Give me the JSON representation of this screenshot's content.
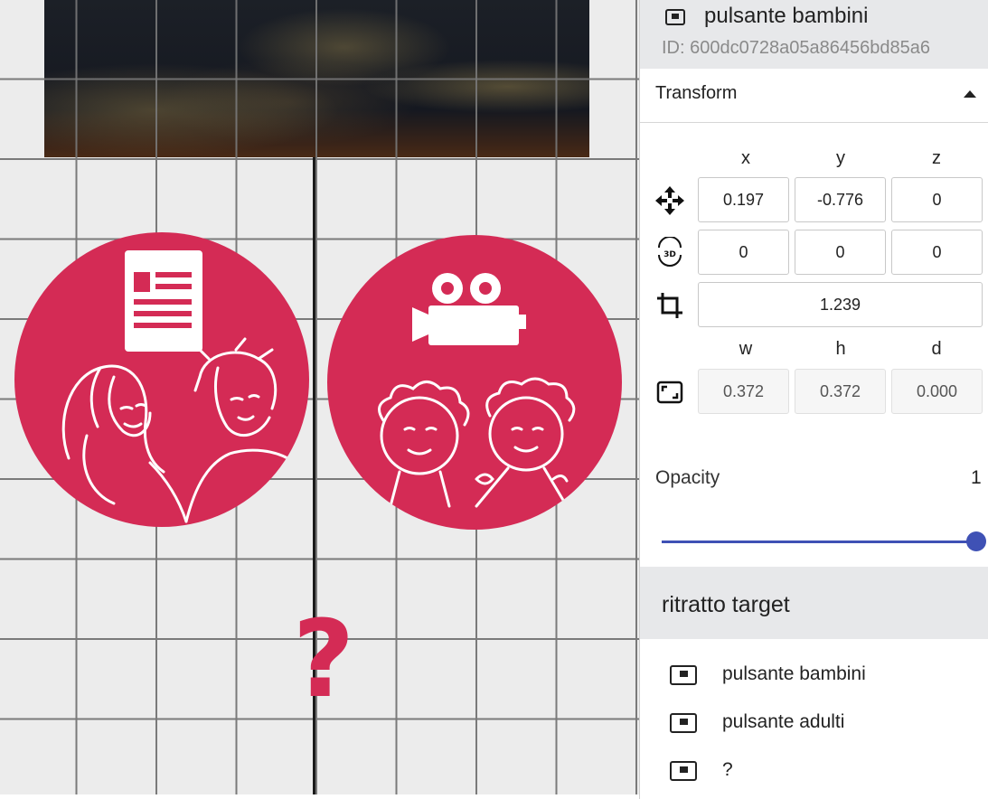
{
  "selected_object": {
    "name": "pulsante bambini",
    "id": "ID: 600dc0728a05a86456bd85a6",
    "icon": "frame-icon"
  },
  "transform": {
    "title": "Transform",
    "columns_xyz": [
      "x",
      "y",
      "z"
    ],
    "columns_whd": [
      "w",
      "h",
      "d"
    ],
    "position": {
      "icon": "move-icon",
      "x": "0.197",
      "y": "-0.776",
      "z": "0"
    },
    "rotation": {
      "icon": "rotate-3d-icon",
      "x": "0",
      "y": "0",
      "z": "0"
    },
    "scale": {
      "icon": "crop-icon",
      "value": "1.239"
    },
    "size": {
      "icon": "resize-icon",
      "w": "0.372",
      "h": "0.372",
      "d": "0.000"
    }
  },
  "opacity": {
    "label": "Opacity",
    "value": "1",
    "level": 1.0,
    "accent": "#3f51b5"
  },
  "scene": {
    "title": "ritratto target",
    "items": [
      {
        "label": "pulsante bambini",
        "icon": "frame-icon"
      },
      {
        "label": "pulsante adulti",
        "icon": "frame-icon"
      },
      {
        "label": "?",
        "icon": "frame-icon"
      }
    ]
  },
  "canvas": {
    "button_color": "#d42b55",
    "question_mark": "?",
    "buttons": [
      {
        "name": "adulti-button",
        "icons": [
          "document-icon",
          "two-adults-drawing"
        ]
      },
      {
        "name": "bambini-button",
        "icons": [
          "video-camera-icon",
          "two-children-drawing"
        ]
      }
    ]
  }
}
